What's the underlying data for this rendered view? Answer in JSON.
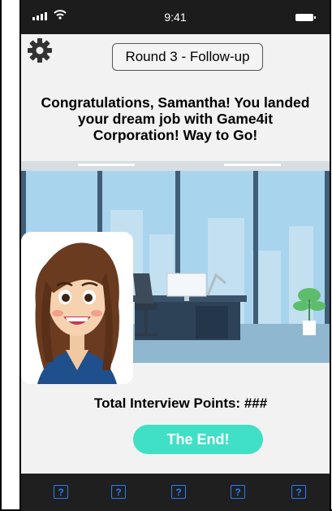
{
  "status_bar": {
    "time": "9:41"
  },
  "header": {
    "round_label": "Round 3 - Follow-up"
  },
  "message": {
    "congrats": "Congratulations, Samantha! You landed your dream job with Game4it Corporation! Way to Go!"
  },
  "score": {
    "points_label": "Total Interview Points: ###"
  },
  "actions": {
    "end_label": "The End!"
  },
  "tabbar": {
    "items": [
      "?",
      "?",
      "?",
      "?",
      "?"
    ]
  },
  "colors": {
    "accent": "#3fe0c6",
    "tab_icon": "#2a7cff",
    "bar_bg": "#1f1f1f"
  },
  "icons": [
    "settings-gear-icon",
    "signal-icon",
    "wifi-icon",
    "battery-icon",
    "help-icon"
  ]
}
